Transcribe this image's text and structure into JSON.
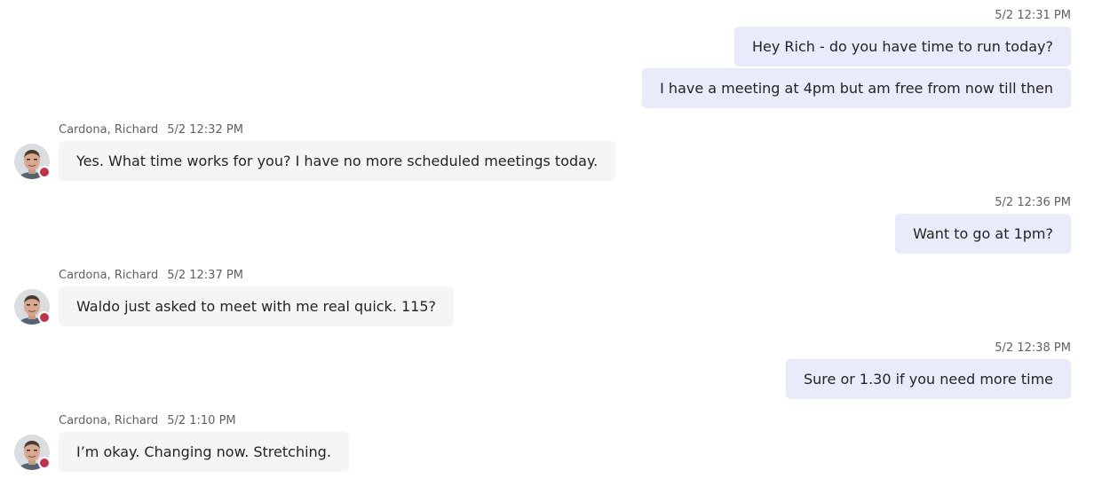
{
  "messages": [
    {
      "sender": "me",
      "timestamp": "5/2 12:31 PM"
    },
    {
      "text": "Hey Rich - do you have time to run today?"
    },
    {
      "text": "I have a meeting at 4pm but am free from now till then"
    },
    {
      "sender": "Cardona, Richard",
      "timestamp": "5/2 12:32 PM",
      "text": "Yes. What time works for you?  I have no more scheduled meetings today."
    },
    {
      "sender": "me",
      "timestamp": "5/2 12:36 PM",
      "text": "Want to go at 1pm?"
    },
    {
      "sender": "Cardona, Richard",
      "timestamp": "5/2 12:37 PM",
      "text": "Waldo just asked to meet with me real quick. 115?"
    },
    {
      "sender": "me",
      "timestamp": "5/2 12:38 PM",
      "text": "Sure or 1.30 if you need more time"
    },
    {
      "sender": "Cardona, Richard",
      "timestamp": "5/2 1:10 PM",
      "text": "I’m okay.  Changing now. Stretching."
    }
  ],
  "presence_status": {
    "color": "#c4314b",
    "state": "busy"
  },
  "colors": {
    "my_bubble": "#e8ebfa",
    "their_bubble": "#f5f5f5",
    "meta_text": "#616161"
  }
}
